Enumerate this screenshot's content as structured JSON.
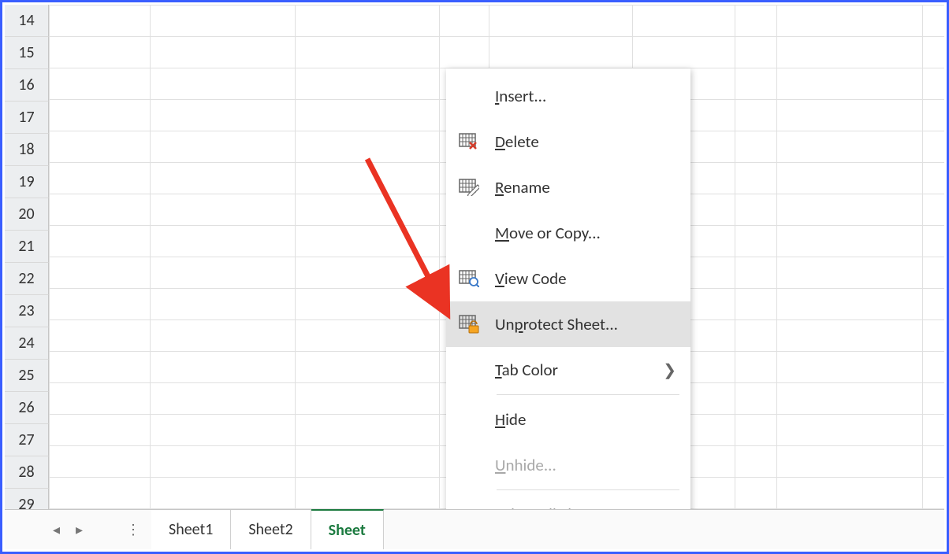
{
  "rows": [
    14,
    15,
    16,
    17,
    18,
    19,
    20,
    21,
    22,
    23,
    24,
    25,
    26,
    27,
    28,
    29
  ],
  "columns_x": [
    0,
    128,
    312,
    495,
    558,
    740,
    870,
    923,
    1108,
    1290
  ],
  "tabs": {
    "sheet1": "Sheet1",
    "sheet2": "Sheet2",
    "sheet3_active": "Sheet"
  },
  "menu": {
    "insert": "Insert...",
    "delete": "Delete",
    "rename": "Rename",
    "move_copy": "Move or Copy...",
    "view_code": "View Code",
    "unprotect": "Unprotect Sheet...",
    "tab_color": "Tab Color",
    "hide": "Hide",
    "unhide": "Unhide...",
    "select_all": "Select All Sheets",
    "accel": {
      "insert": "I",
      "delete": "D",
      "rename": "R",
      "move_copy": "M",
      "view_code": "V",
      "unprotect": "P",
      "tab_color": "T",
      "hide": "H",
      "unhide": "U",
      "select_all": "S"
    }
  }
}
